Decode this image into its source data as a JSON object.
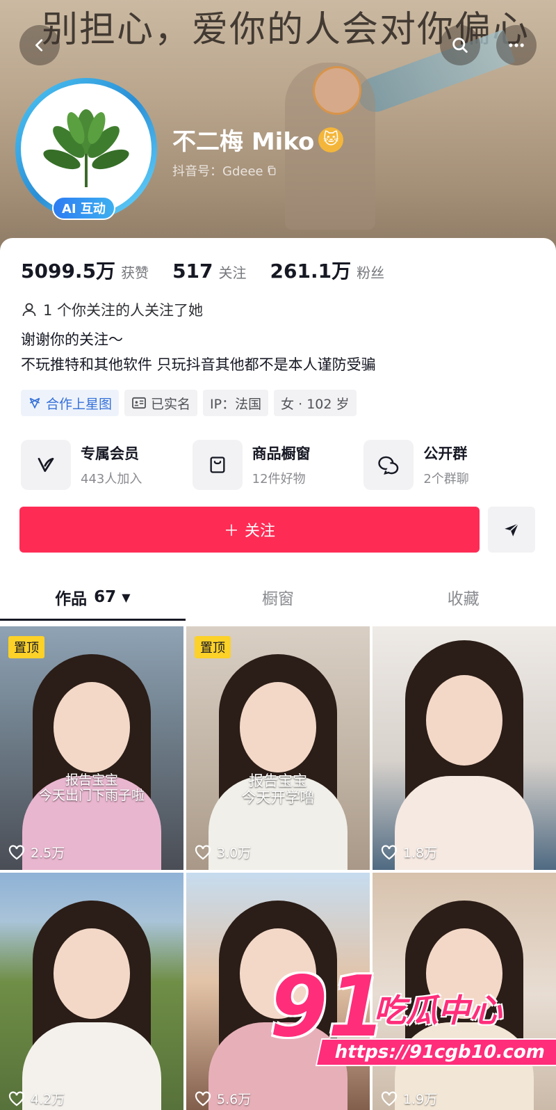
{
  "banner": {
    "script_text": "别担心，爱你的人会对你偏心"
  },
  "header": {
    "nickname": "不二梅 Miko",
    "nickname_emoji": "🐱",
    "douyin_id": "抖音号：Gdeee",
    "ai_badge": "AI 互动"
  },
  "stats": [
    {
      "value": "5099.5万",
      "label": "获赞"
    },
    {
      "value": "517",
      "label": "关注"
    },
    {
      "value": "261.1万",
      "label": "粉丝"
    }
  ],
  "follow_note": "1 个你关注的人关注了她",
  "bio": {
    "line1": "谢谢你的关注～",
    "line2": "不玩推特和其他软件 只玩抖音其他都不是本人谨防受骗"
  },
  "tags": [
    {
      "label": "合作上星图",
      "icon": "star-map-icon"
    },
    {
      "label": "已实名",
      "icon": "id-card-icon"
    },
    {
      "label": "IP：法国"
    },
    {
      "label": "女 · 102 岁"
    }
  ],
  "features": [
    {
      "title": "专属会员",
      "sub": "443人加入",
      "icon": "vip-v-icon"
    },
    {
      "title": "商品橱窗",
      "sub": "12件好物",
      "icon": "shop-bag-icon"
    },
    {
      "title": "公开群",
      "sub": "2个群聊",
      "icon": "group-chat-icon"
    }
  ],
  "actions": {
    "follow_label": "关注",
    "follow_plus": "＋"
  },
  "tabs": [
    {
      "label": "作品",
      "count": "67",
      "caret": "▼"
    },
    {
      "label": "橱窗"
    },
    {
      "label": "收藏"
    }
  ],
  "videos": [
    {
      "pinned": "置顶",
      "caption1": "报告宝宝",
      "caption2": "今天出门下雨子啦",
      "likes": "2.5万"
    },
    {
      "pinned": "置顶",
      "caption1": "报告宝宝",
      "caption2": "今天开学噜",
      "likes": "3.0万"
    },
    {
      "likes": "1.8万"
    },
    {
      "likes": "4.2万"
    },
    {
      "likes": "5.6万"
    },
    {
      "likes": "1.9万"
    }
  ],
  "watermark": {
    "number": "91",
    "text": "吃瓜中心",
    "url": "https://91cgb10.com"
  },
  "colors": {
    "follow_red": "#fe2c55",
    "pin_yellow": "#fcd128",
    "watermark_pink": "#ff2d7a"
  }
}
